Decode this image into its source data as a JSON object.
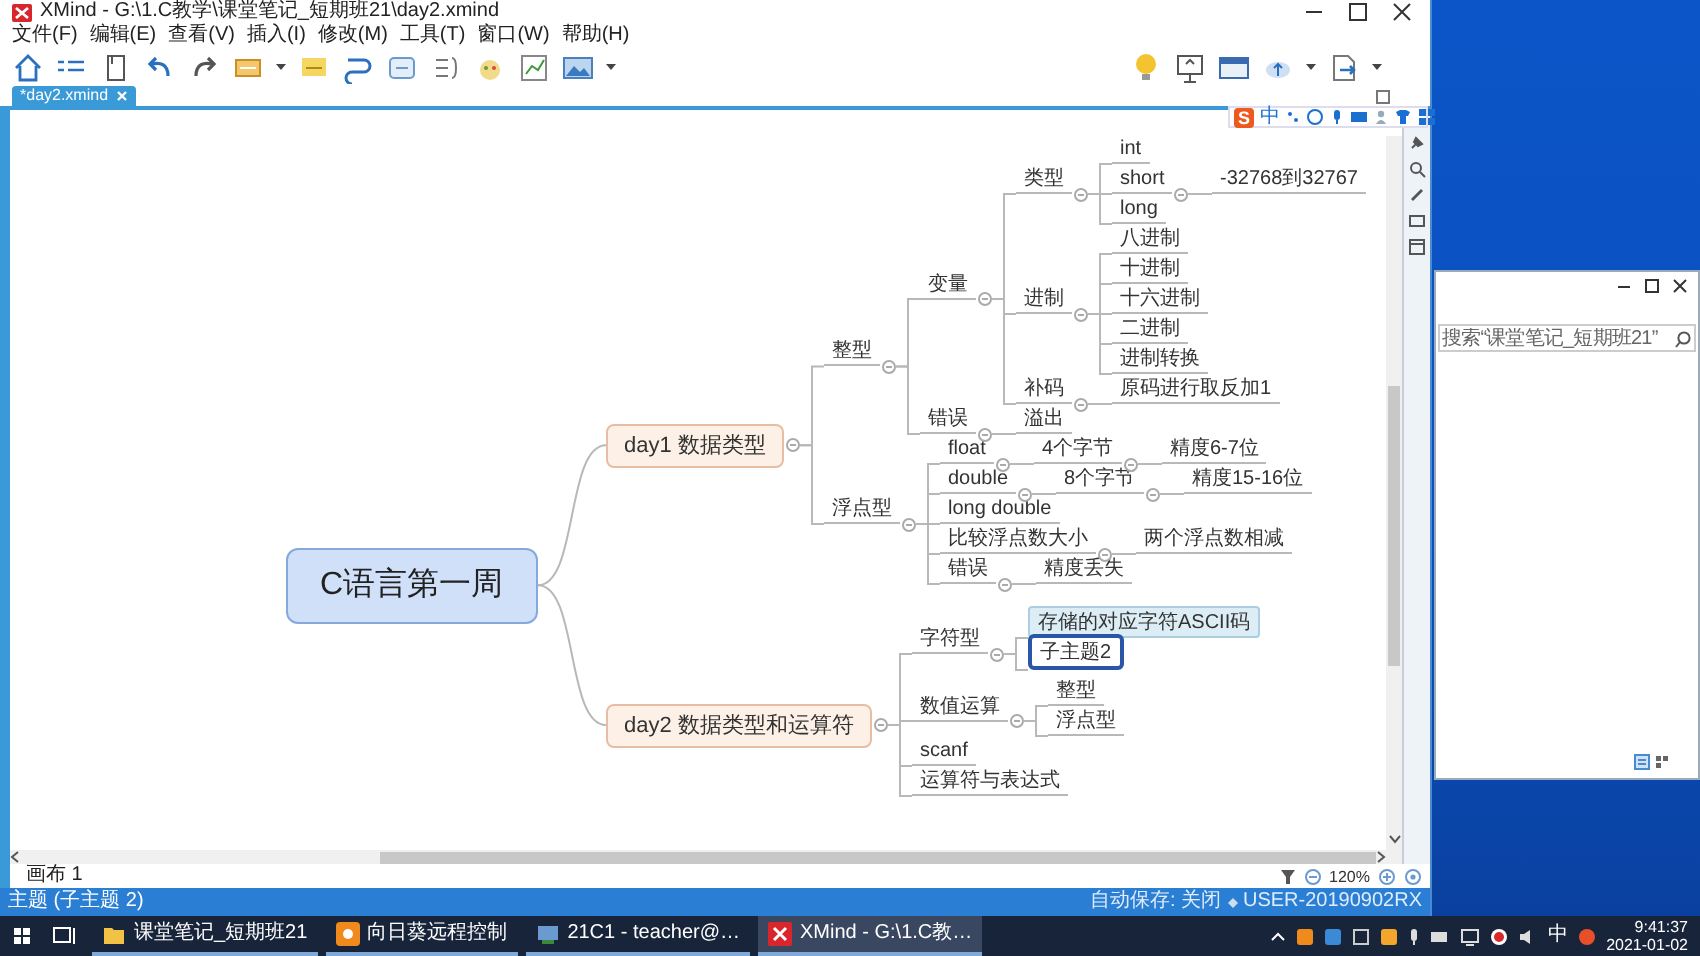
{
  "window": {
    "title": "XMind - G:\\1.C教学\\课堂笔记_短期班21\\day2.xmind"
  },
  "menu": [
    "文件(F)",
    "编辑(E)",
    "查看(V)",
    "插入(I)",
    "修改(M)",
    "工具(T)",
    "窗口(W)",
    "帮助(H)"
  ],
  "tabs": [
    {
      "label": "*day2.xmind",
      "selected": true
    }
  ],
  "mindmap": {
    "text": "C语言第一周",
    "kind": "central",
    "selected": false,
    "hovered": false,
    "children": [
      {
        "text": "day1 数据类型",
        "kind": "main",
        "selected": false,
        "hovered": false,
        "children": [
          {
            "text": "整型",
            "kind": "topic",
            "selected": false,
            "hovered": false,
            "children": [
              {
                "text": "变量",
                "kind": "topic",
                "selected": false,
                "hovered": false,
                "children": [
                  {
                    "text": "类型",
                    "kind": "topic",
                    "selected": false,
                    "hovered": false,
                    "children": [
                      {
                        "text": "int",
                        "kind": "topic",
                        "selected": false,
                        "hovered": false
                      },
                      {
                        "text": "short",
                        "kind": "topic",
                        "selected": false,
                        "hovered": false,
                        "children": [
                          {
                            "text": "-32768到32767",
                            "kind": "topic",
                            "selected": false,
                            "hovered": false
                          }
                        ]
                      },
                      {
                        "text": "long",
                        "kind": "topic",
                        "selected": false,
                        "hovered": false
                      }
                    ]
                  },
                  {
                    "text": "进制",
                    "kind": "topic",
                    "selected": false,
                    "hovered": false,
                    "children": [
                      {
                        "text": "八进制",
                        "kind": "topic",
                        "selected": false,
                        "hovered": false
                      },
                      {
                        "text": "十进制",
                        "kind": "topic",
                        "selected": false,
                        "hovered": false
                      },
                      {
                        "text": "十六进制",
                        "kind": "topic",
                        "selected": false,
                        "hovered": false
                      },
                      {
                        "text": "二进制",
                        "kind": "topic",
                        "selected": false,
                        "hovered": false
                      },
                      {
                        "text": "进制转换",
                        "kind": "topic",
                        "selected": false,
                        "hovered": false
                      }
                    ]
                  },
                  {
                    "text": "补码",
                    "kind": "topic",
                    "selected": false,
                    "hovered": false,
                    "children": [
                      {
                        "text": "原码进行取反加1",
                        "kind": "topic",
                        "selected": false,
                        "hovered": false
                      }
                    ]
                  }
                ]
              },
              {
                "text": "错误",
                "kind": "topic",
                "selected": false,
                "hovered": false,
                "children": [
                  {
                    "text": "溢出",
                    "kind": "topic",
                    "selected": false,
                    "hovered": false
                  }
                ]
              }
            ]
          },
          {
            "text": "浮点型",
            "kind": "topic",
            "selected": false,
            "hovered": false,
            "children": [
              {
                "text": "float",
                "kind": "topic",
                "selected": false,
                "hovered": false,
                "children": [
                  {
                    "text": "4个字节",
                    "kind": "topic",
                    "selected": false,
                    "hovered": false,
                    "children": [
                      {
                        "text": "精度6-7位",
                        "kind": "topic",
                        "selected": false,
                        "hovered": false
                      }
                    ]
                  }
                ]
              },
              {
                "text": "double",
                "kind": "topic",
                "selected": false,
                "hovered": false,
                "children": [
                  {
                    "text": "8个字节",
                    "kind": "topic",
                    "selected": false,
                    "hovered": false,
                    "children": [
                      {
                        "text": "精度15-16位",
                        "kind": "topic",
                        "selected": false,
                        "hovered": false
                      }
                    ]
                  }
                ]
              },
              {
                "text": "long double",
                "kind": "topic",
                "selected": false,
                "hovered": false
              },
              {
                "text": "比较浮点数大小",
                "kind": "topic",
                "selected": false,
                "hovered": false,
                "children": [
                  {
                    "text": "两个浮点数相减",
                    "kind": "topic",
                    "selected": false,
                    "hovered": false
                  }
                ]
              },
              {
                "text": "错误",
                "kind": "topic",
                "selected": false,
                "hovered": false,
                "children": [
                  {
                    "text": "精度丢失",
                    "kind": "topic",
                    "selected": false,
                    "hovered": false
                  }
                ]
              }
            ]
          }
        ]
      },
      {
        "text": "day2 数据类型和运算符",
        "kind": "main",
        "selected": false,
        "hovered": false,
        "children": [
          {
            "text": "字符型",
            "kind": "topic",
            "selected": false,
            "hovered": false,
            "children": [
              {
                "text": "存储的对应字符ASCII码",
                "kind": "topic",
                "selected": false,
                "hovered": true
              },
              {
                "text": "子主题2",
                "kind": "topic",
                "selected": true,
                "hovered": false
              }
            ]
          },
          {
            "text": "数值运算",
            "kind": "topic",
            "selected": false,
            "hovered": false,
            "children": [
              {
                "text": "整型",
                "kind": "topic",
                "selected": false,
                "hovered": false
              },
              {
                "text": "浮点型",
                "kind": "topic",
                "selected": false,
                "hovered": false
              }
            ]
          },
          {
            "text": "scanf",
            "kind": "topic",
            "selected": false,
            "hovered": false
          },
          {
            "text": "运算符与表达式",
            "kind": "topic",
            "selected": false,
            "hovered": false
          }
        ]
      }
    ]
  },
  "ime_bar": {
    "logo": "S",
    "mode": "中"
  },
  "canvas_status": {
    "sheet": "画布 1",
    "zoom": "120%"
  },
  "status_bar": {
    "selection": "主题 (子主题 2)",
    "autosave": "自动保存: 关闭",
    "user": "USER-20190902RX"
  },
  "explorer_window": {
    "search": {
      "placeholder": "搜索“课堂笔记_短期班21”"
    }
  },
  "taskbar": {
    "apps": [
      {
        "label": "课堂笔记_短期班21",
        "kind": "folder",
        "selected": false
      },
      {
        "label": "向日葵远程控制",
        "kind": "remote",
        "selected": false
      },
      {
        "label": "21C1 - teacher@…",
        "kind": "terminal",
        "selected": false
      },
      {
        "label": "XMind - G:\\1.C教…",
        "kind": "xmind",
        "selected": true
      }
    ],
    "ime": "中",
    "time": "9:41:37",
    "date": "2021-01-02"
  }
}
